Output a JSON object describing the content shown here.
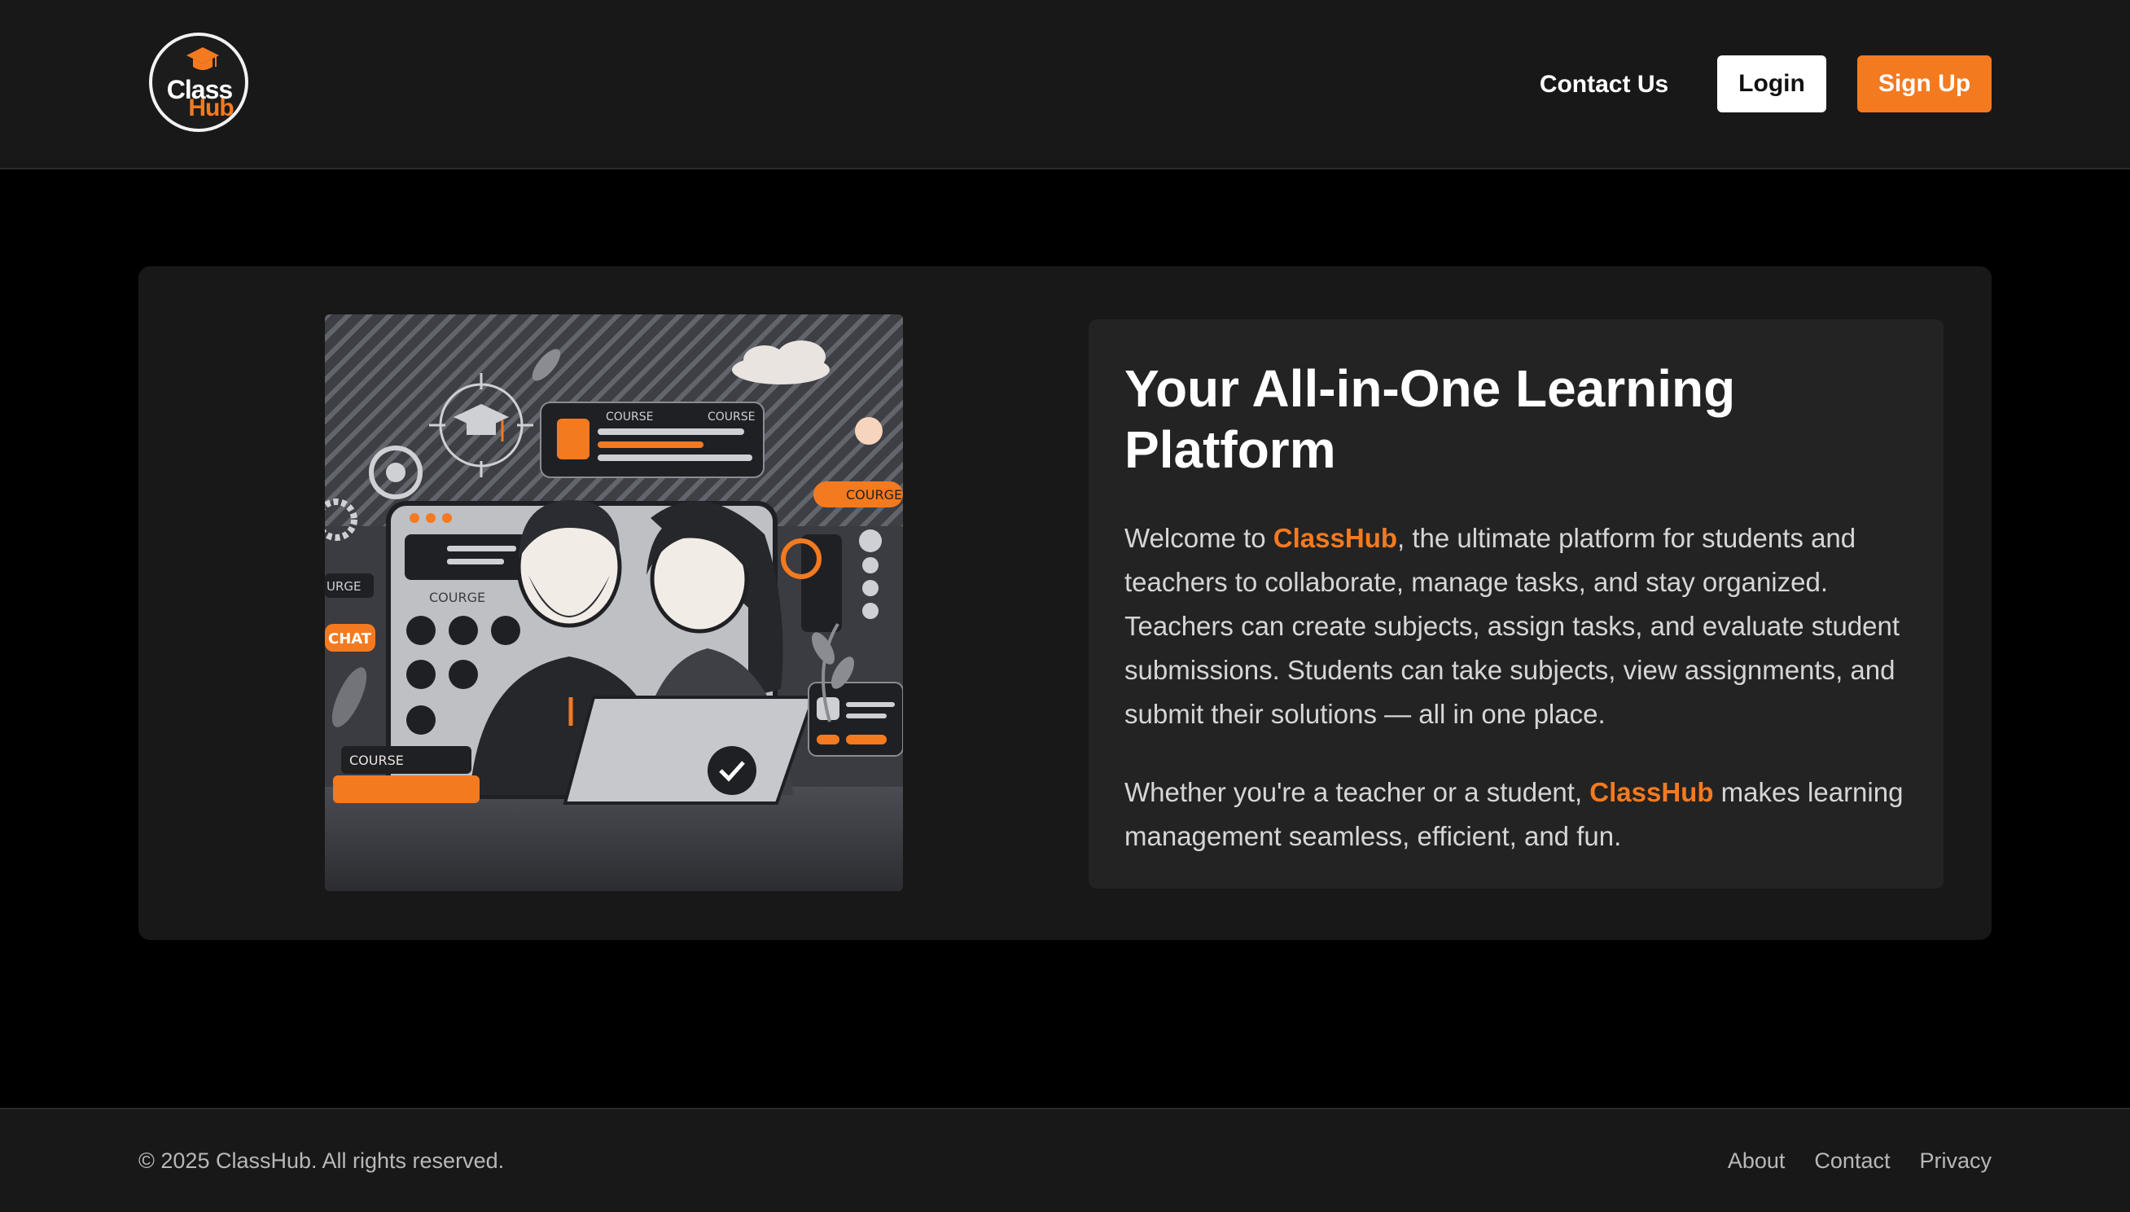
{
  "brand": {
    "logo_line1": "Class",
    "logo_line2": "Hub",
    "accent_color": "#f47a20"
  },
  "nav": {
    "contact_label": "Contact Us",
    "login_label": "Login",
    "signup_label": "Sign Up"
  },
  "hero": {
    "title": "Your All-in-One Learning Platform",
    "p1_prefix": "Welcome to ",
    "p1_brand": "ClassHub",
    "p1_suffix": ", the ultimate platform for students and teachers to collaborate, manage tasks, and stay organized. Teachers can create subjects, assign tasks, and evaluate student submissions. Students can take subjects, view assignments, and submit their solutions — all in one place.",
    "p2_prefix": "Whether you're a teacher or a student, ",
    "p2_brand": "ClassHub",
    "p2_suffix": " makes learning management seamless, efficient, and fun.",
    "illustration": {
      "labels": [
        "COURSE",
        "COURSE",
        "COURSE",
        "COURGE",
        "COURGE",
        "CHAT",
        "COURSE"
      ]
    }
  },
  "footer": {
    "copyright": "© 2025 ClassHub. All rights reserved.",
    "links": [
      "About",
      "Contact",
      "Privacy"
    ]
  }
}
